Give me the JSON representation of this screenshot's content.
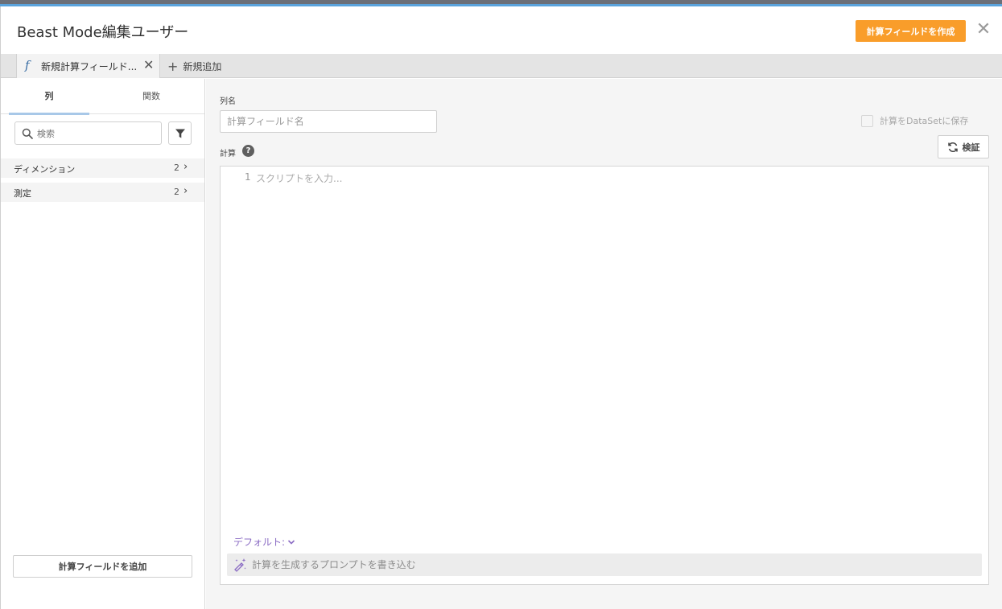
{
  "header": {
    "title": "Beast Mode編集ユーザー",
    "create_button": "計算フィールドを作成",
    "close_glyph": "✕"
  },
  "tabs": {
    "active_label": "新規計算フィールド...",
    "close_glyph": "✕",
    "add_label": "新規追加",
    "add_glyph": "+"
  },
  "sidebar": {
    "tab_columns": "列",
    "tab_functions": "関数",
    "search_placeholder": "検索",
    "categories": [
      {
        "label": "ディメンション",
        "count": "2"
      },
      {
        "label": "測定",
        "count": "2"
      }
    ],
    "add_field_button": "計算フィールドを追加"
  },
  "main": {
    "column_name_label": "列名",
    "column_name_placeholder": "計算フィールド名",
    "save_to_dataset_label": "計算をDataSetに保存",
    "calc_label": "計算",
    "help_glyph": "?",
    "verify_button": "検証",
    "editor_line_number": "1",
    "editor_placeholder": "スクリプトを入力...",
    "default_selector": "デフォルト:",
    "prompt_placeholder": "計算を生成するプロンプトを書き込む"
  },
  "colors": {
    "accent_orange": "#f99d2a",
    "tab_underline": "#a8c8e8",
    "ai_purple": "#8b6cc4"
  }
}
